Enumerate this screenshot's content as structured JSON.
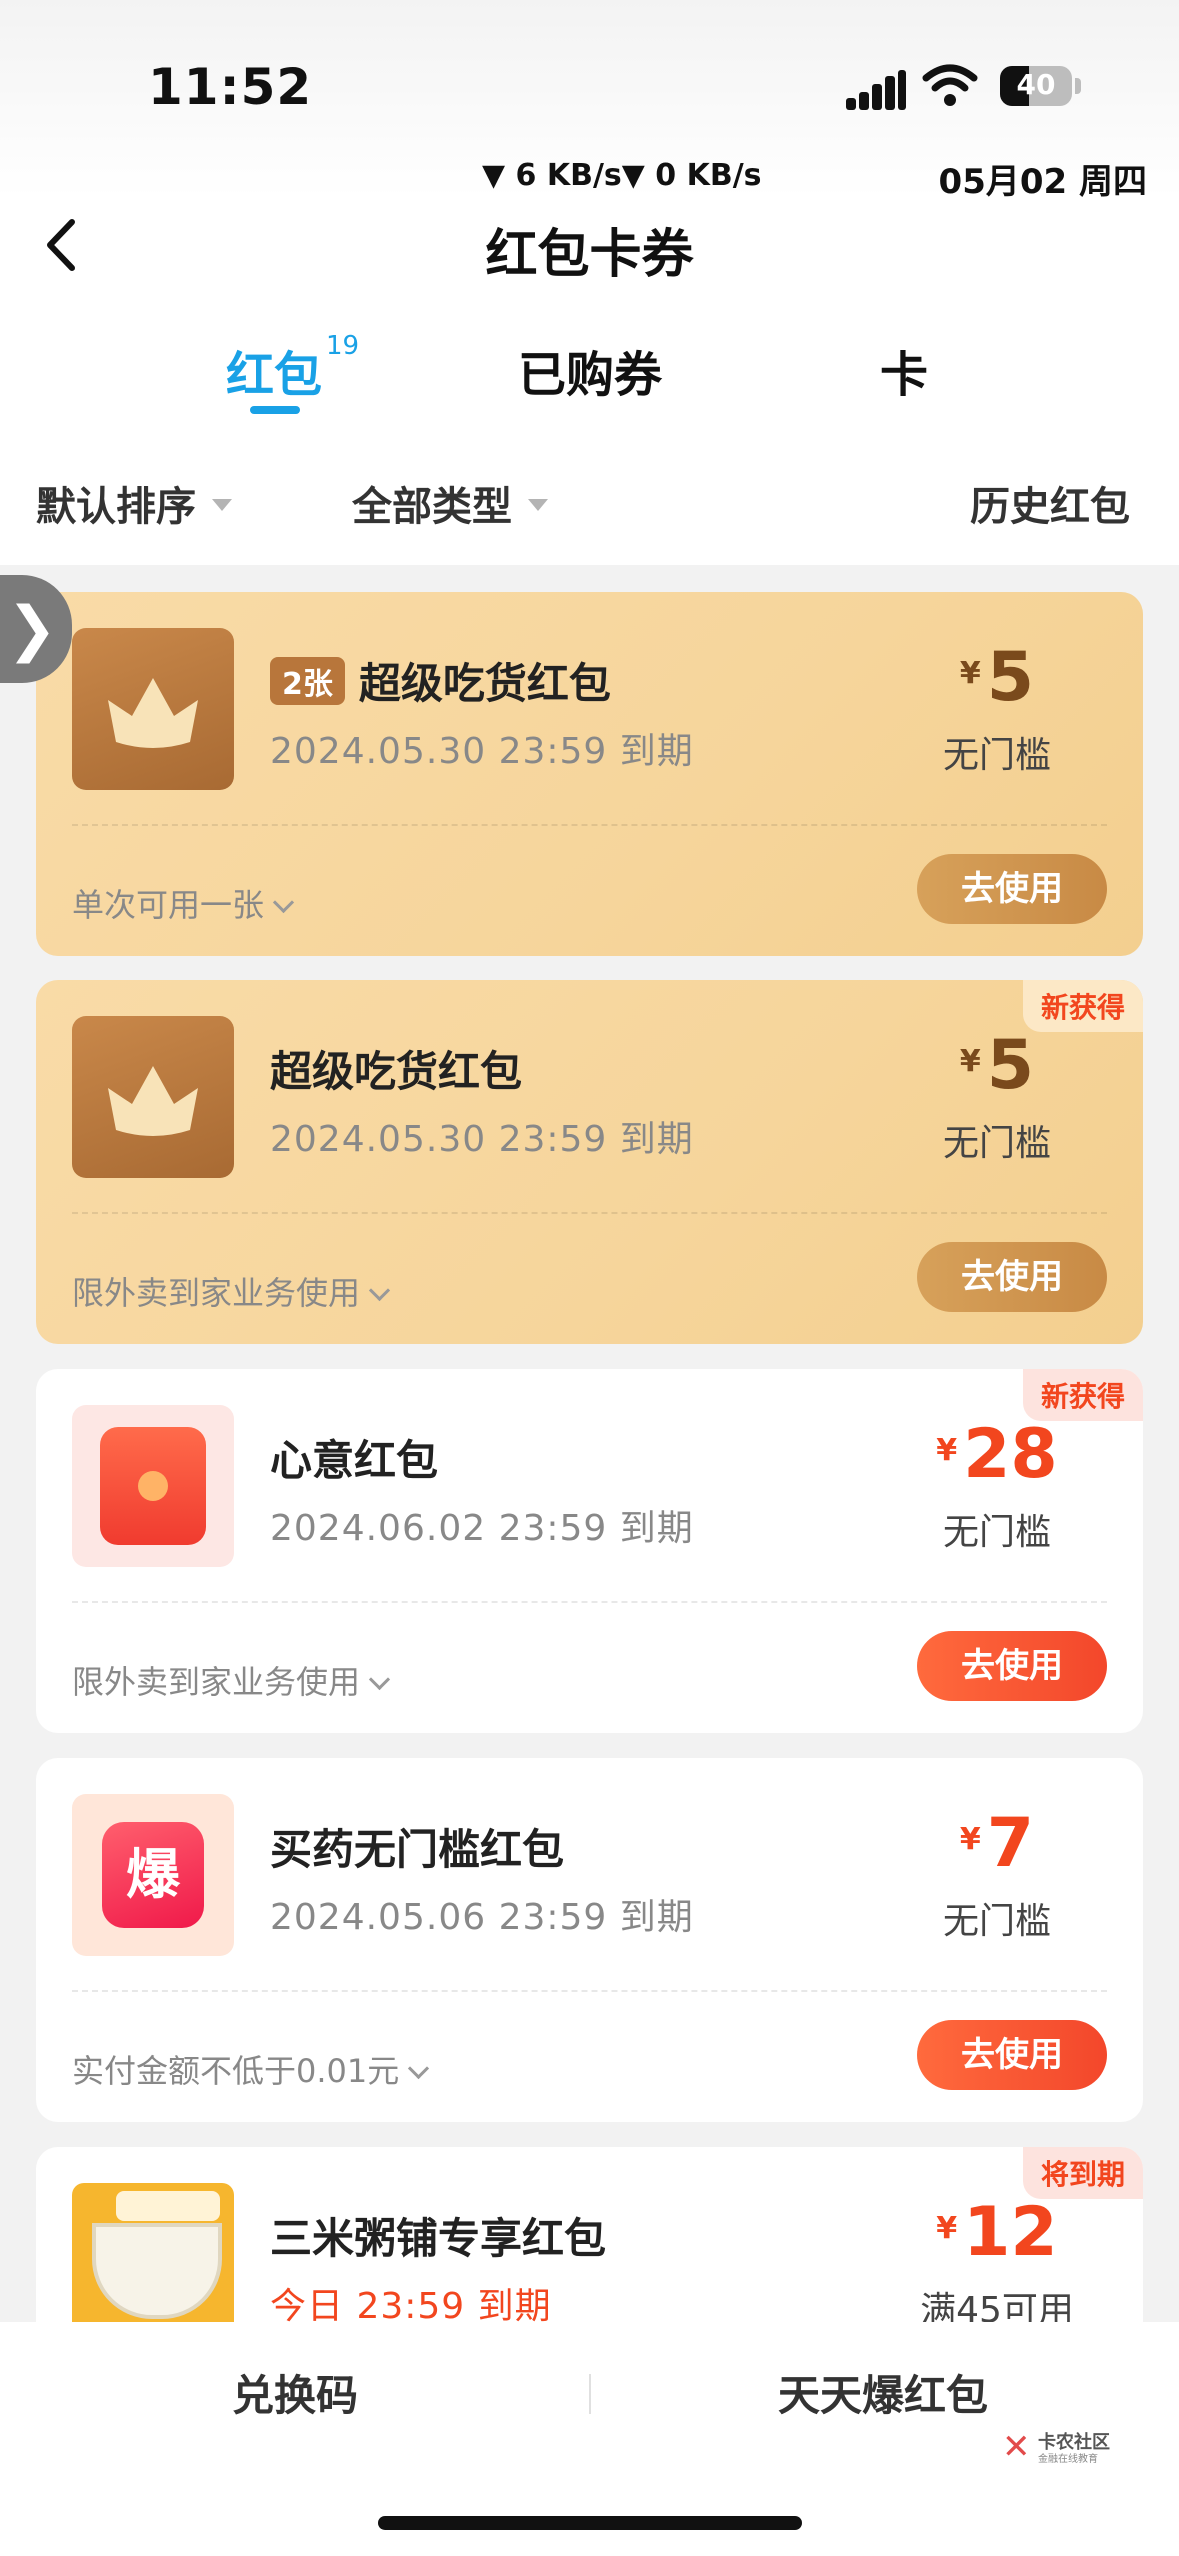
{
  "status_bar": {
    "time": "11:52",
    "battery": "40",
    "battery_level": 0.4,
    "net_speed": "▼ 6 KB/s▼ 0 KB/s",
    "date": "05月02 周四"
  },
  "header": {
    "title": "红包卡券"
  },
  "tabs": [
    {
      "label": "红包",
      "badge": "19",
      "active": true
    },
    {
      "label": "已购券"
    },
    {
      "label": "卡"
    }
  ],
  "filters": {
    "sort": "默认排序",
    "type": "全部类型",
    "history": "历史红包"
  },
  "side_handle": "❯",
  "cards": [
    {
      "style": "gold",
      "icon": "crown-icon",
      "count_tag": "2张",
      "name": "超级吃货红包",
      "expire": "2024.05.30 23:59 到期",
      "currency": "¥",
      "amount": "5",
      "condition": "无门槛",
      "note": "单次可用一张",
      "button": "去使用"
    },
    {
      "style": "gold",
      "icon": "crown-icon",
      "tag": "新获得",
      "name": "超级吃货红包",
      "expire": "2024.05.30 23:59 到期",
      "currency": "¥",
      "amount": "5",
      "condition": "无门槛",
      "note": "限外卖到家业务使用",
      "button": "去使用"
    },
    {
      "style": "white",
      "icon": "red-packet-icon",
      "tag": "新获得",
      "name": "心意红包",
      "expire": "2024.06.02 23:59 到期",
      "currency": "¥",
      "amount": "28",
      "condition": "无门槛",
      "note": "限外卖到家业务使用",
      "button": "去使用"
    },
    {
      "style": "white",
      "icon": "boom-icon",
      "icon_text": "爆",
      "name": "买药无门槛红包",
      "expire": "2024.05.06 23:59 到期",
      "currency": "¥",
      "amount": "7",
      "condition": "无门槛",
      "note": "实付金额不低于0.01元",
      "button": "去使用"
    },
    {
      "style": "white",
      "icon": "shop-logo",
      "tag": "将到期",
      "name": "三米粥铺专享红包",
      "expire": "今日 23:59 到期",
      "currency": "¥",
      "amount": "12",
      "condition": "满45可用"
    }
  ],
  "bottom_bar": {
    "redeem": "兑换码",
    "daily": "天天爆红包"
  },
  "watermark": {
    "title": "卡农社区",
    "subtitle": "金融在线教育"
  },
  "colors": {
    "accent_blue": "#19a1e6",
    "red": "#f2461e",
    "gold_bg": "#f6d59b"
  }
}
